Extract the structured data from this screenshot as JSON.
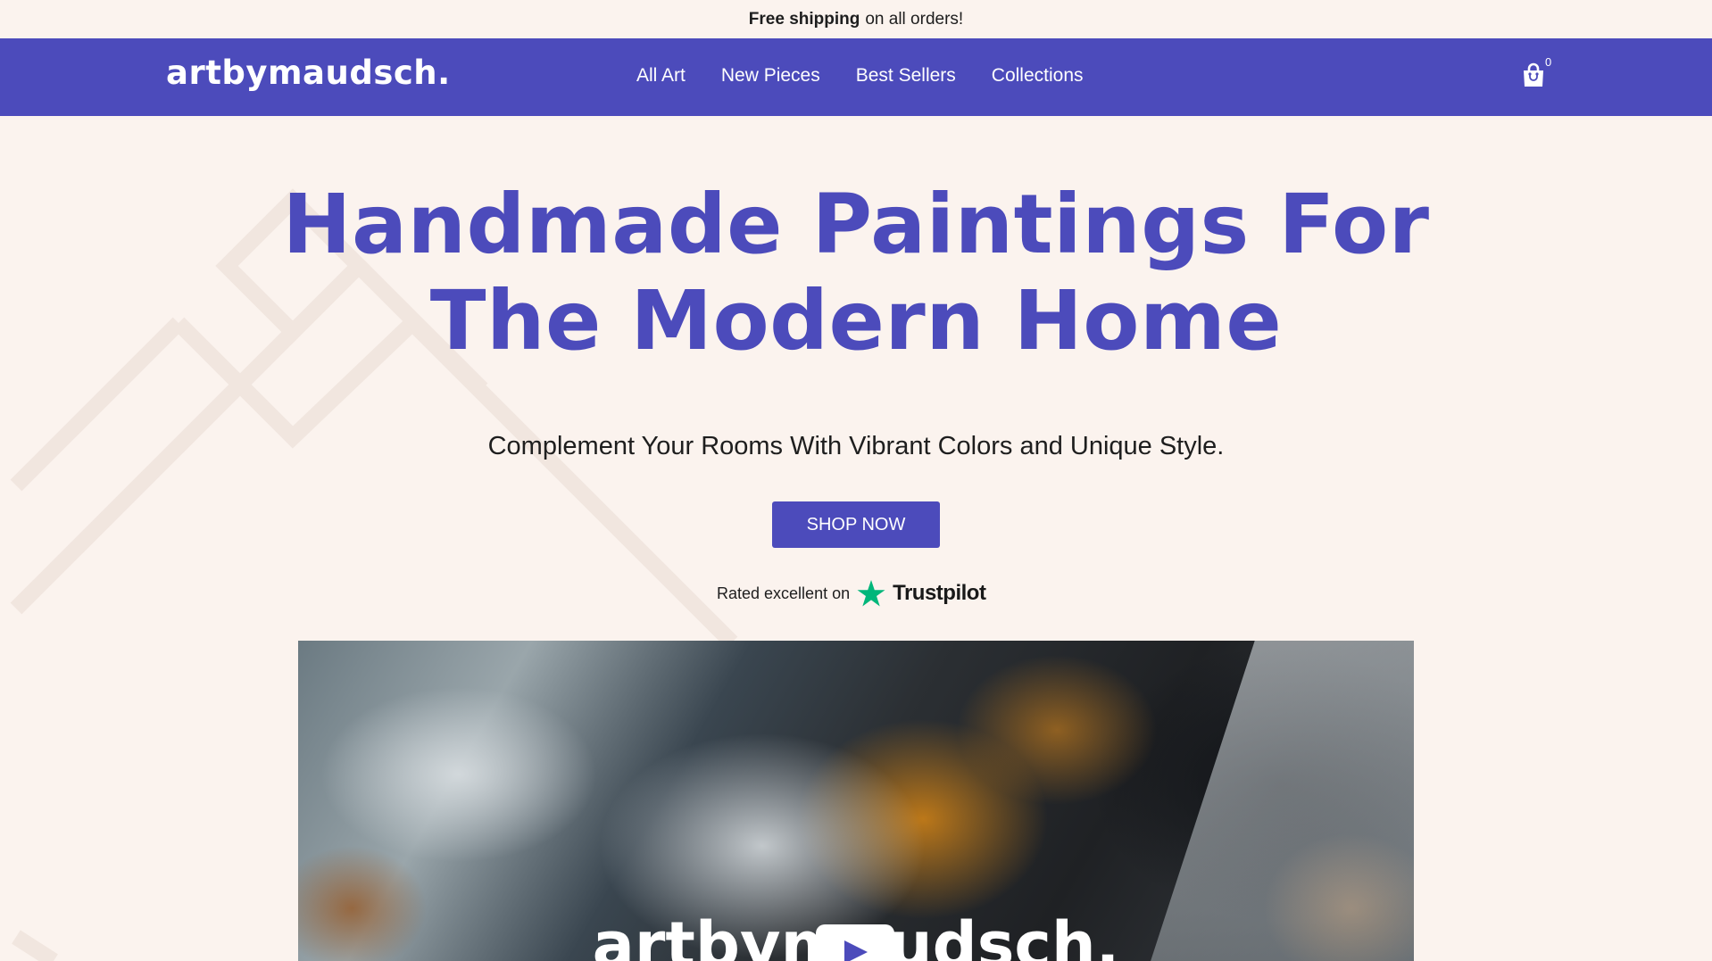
{
  "announcement": {
    "bold": "Free shipping",
    "rest": "on all orders!"
  },
  "header": {
    "logo": "artbymaudsch.",
    "nav": [
      "All Art",
      "New Pieces",
      "Best Sellers",
      "Collections"
    ],
    "cart_count": "0",
    "cart_icon": "shopping-bag-icon"
  },
  "hero": {
    "title_line1": "Handmade Paintings For",
    "title_line2": "The Modern Home",
    "subtitle": "Complement Your Rooms With Vibrant Colors and Unique Style.",
    "cta": "SHOP NOW",
    "trust_text": "Rated excellent on",
    "trust_brand": "Trustpilot",
    "trust_icon": "star-icon"
  },
  "video": {
    "overlay_logo": "artbymaudsch.",
    "play_icon": "play-icon"
  },
  "colors": {
    "brand": "#4c4bbb",
    "background": "#fbf3ee",
    "trustpilot": "#00b67a"
  }
}
